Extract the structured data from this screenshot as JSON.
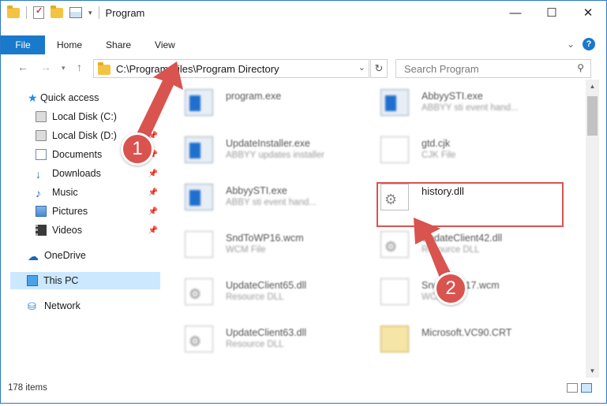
{
  "window": {
    "title": "Program"
  },
  "ribbon": {
    "file": "File",
    "tabs": [
      "Home",
      "Share",
      "View"
    ]
  },
  "address": {
    "path": "C:\\Program Files\\Program Directory"
  },
  "search": {
    "placeholder": "Search Program"
  },
  "sidebar": {
    "items": [
      {
        "label": "Quick access",
        "icon": "star-icon"
      },
      {
        "label": "Local Disk (C:)",
        "icon": "drive-icon"
      },
      {
        "label": "Local Disk (D:)",
        "icon": "drive-icon"
      },
      {
        "label": "Documents",
        "icon": "documents-icon"
      },
      {
        "label": "Downloads",
        "icon": "downloads-icon"
      },
      {
        "label": "Music",
        "icon": "music-icon"
      },
      {
        "label": "Pictures",
        "icon": "pictures-icon"
      },
      {
        "label": "Videos",
        "icon": "videos-icon"
      },
      {
        "label": "OneDrive",
        "icon": "cloud-icon"
      },
      {
        "label": "This PC",
        "icon": "computer-icon"
      },
      {
        "label": "Network",
        "icon": "network-icon"
      }
    ]
  },
  "files": [
    {
      "name": "program.exe",
      "desc": "",
      "icon": "exe-icon"
    },
    {
      "name": "AbbyySTI.exe",
      "desc": "ABBYY sti event hand...",
      "icon": "exe-icon"
    },
    {
      "name": "UpdateInstaller.exe",
      "desc": "ABBYY updates installer",
      "icon": "exe-icon"
    },
    {
      "name": "gtd.cjk",
      "desc": "CJK File",
      "icon": "file-icon"
    },
    {
      "name": "AbbyySTI.exe",
      "desc": "ABBY sti event hand...",
      "icon": "exe-icon"
    },
    {
      "name": "history.dll",
      "desc": "",
      "icon": "dll-icon"
    },
    {
      "name": "SndToWP16.wcm",
      "desc": "WCM File",
      "icon": "file-icon"
    },
    {
      "name": "UpdateClient42.dll",
      "desc": "Resource DLL",
      "icon": "dll-icon"
    },
    {
      "name": "UpdateClient65.dll",
      "desc": "Resource DLL",
      "icon": "dll-icon"
    },
    {
      "name": "SndToWP17.wcm",
      "desc": "WCM File",
      "icon": "file-icon"
    },
    {
      "name": "UpdateClient63.dll",
      "desc": "Resource DLL",
      "icon": "dll-icon"
    },
    {
      "name": "Microsoft.VC90.CRT",
      "desc": "",
      "icon": "folder-icon"
    }
  ],
  "status": {
    "count": "178 items"
  },
  "annotations": {
    "step1": "1",
    "step2": "2",
    "color": "#d9534f"
  }
}
